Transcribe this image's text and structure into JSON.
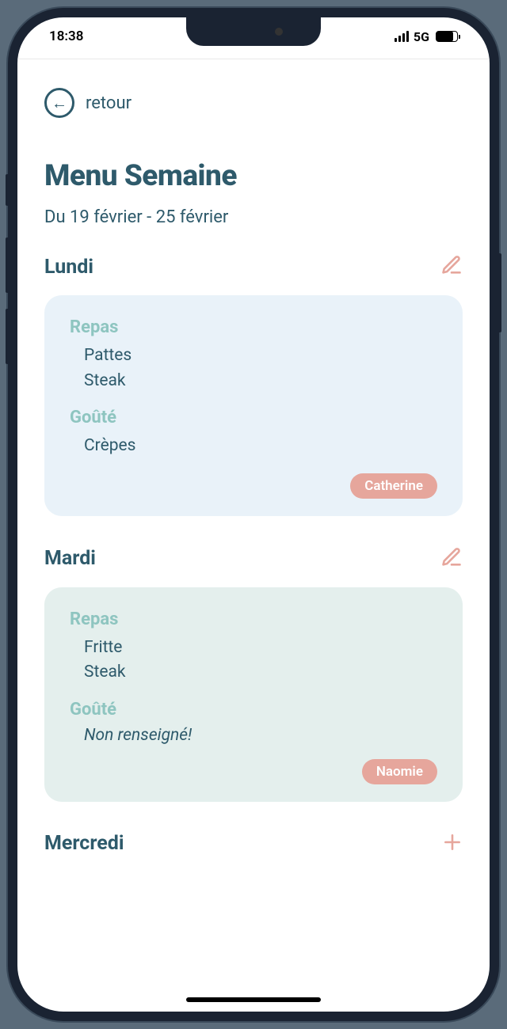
{
  "status": {
    "time": "18:38",
    "network": "5G"
  },
  "nav": {
    "back_label": "retour"
  },
  "page": {
    "title": "Menu Semaine",
    "date_range": "Du 19 février - 25 février"
  },
  "section_labels": {
    "meal": "Repas",
    "snack": "Goûté"
  },
  "empty_text": "Non renseigné!",
  "days": [
    {
      "name": "Lundi",
      "card_class": "card-blue",
      "meals": [
        "Pattes",
        "Steak"
      ],
      "snacks": [
        "Crèpes"
      ],
      "assignee": "Catherine",
      "action": "edit"
    },
    {
      "name": "Mardi",
      "card_class": "card-green",
      "meals": [
        "Fritte",
        "Steak"
      ],
      "snacks": [],
      "assignee": "Naomie",
      "action": "edit"
    },
    {
      "name": "Mercredi",
      "action": "add"
    }
  ]
}
